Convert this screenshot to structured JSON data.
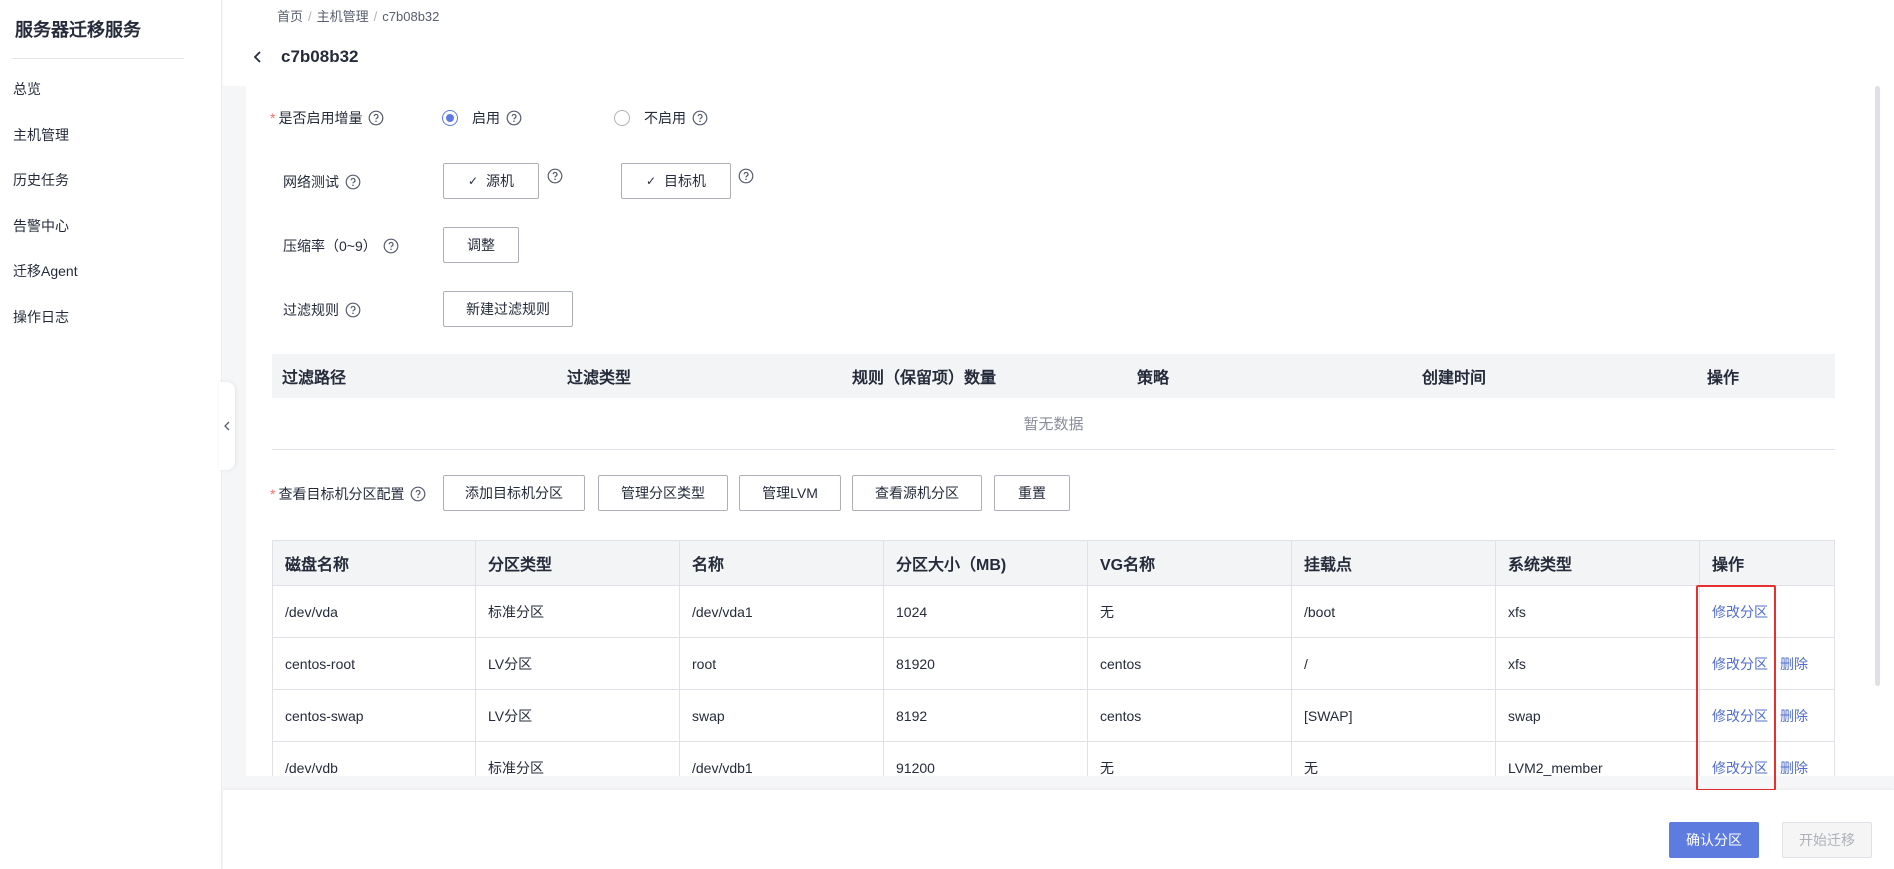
{
  "sidebar": {
    "title": "服务器迁移服务",
    "items": [
      {
        "label": "总览"
      },
      {
        "label": "主机管理"
      },
      {
        "label": "历史任务"
      },
      {
        "label": "告警中心"
      },
      {
        "label": "迁移Agent"
      },
      {
        "label": "操作日志"
      }
    ]
  },
  "header": {
    "breadcrumb": [
      "首页",
      "主机管理",
      "c7b08b32"
    ],
    "title": "c7b08b32"
  },
  "form": {
    "incremental": {
      "label": "是否启用增量",
      "options": [
        {
          "label": "启用",
          "selected": true
        },
        {
          "label": "不启用",
          "selected": false
        }
      ]
    },
    "network_test": {
      "label": "网络测试",
      "source_button": "源机",
      "target_button": "目标机"
    },
    "compression": {
      "label": "压缩率（0~9）",
      "button": "调整"
    },
    "filter": {
      "label": "过滤规则",
      "button": "新建过滤规则",
      "columns": [
        "过滤路径",
        "过滤类型",
        "规则（保留项）数量",
        "策略",
        "创建时间",
        "操作"
      ],
      "empty_text": "暂无数据"
    },
    "partition": {
      "label": "查看目标机分区配置",
      "buttons": [
        "添加目标机分区",
        "管理分区类型",
        "管理LVM",
        "查看源机分区",
        "重置"
      ],
      "columns": [
        "磁盘名称",
        "分区类型",
        "名称",
        "分区大小（MB)",
        "VG名称",
        "挂载点",
        "系统类型",
        "操作"
      ],
      "rows": [
        {
          "disk": "/dev/vda",
          "type": "标准分区",
          "name": "/dev/vda1",
          "size": "1024",
          "vg": "无",
          "mount": "/boot",
          "fs": "xfs",
          "actions": [
            "修改分区"
          ]
        },
        {
          "disk": "centos-root",
          "type": "LV分区",
          "name": "root",
          "size": "81920",
          "vg": "centos",
          "mount": "/",
          "fs": "xfs",
          "actions": [
            "修改分区",
            "删除"
          ]
        },
        {
          "disk": "centos-swap",
          "type": "LV分区",
          "name": "swap",
          "size": "8192",
          "vg": "centos",
          "mount": "[SWAP]",
          "fs": "swap",
          "actions": [
            "修改分区",
            "删除"
          ]
        },
        {
          "disk": "/dev/vdb",
          "type": "标准分区",
          "name": "/dev/vdb1",
          "size": "91200",
          "vg": "无",
          "mount": "无",
          "fs": "LVM2_member",
          "actions": [
            "修改分区",
            "删除"
          ]
        }
      ]
    }
  },
  "footer": {
    "confirm_button": "确认分区",
    "start_button": "开始迁移"
  },
  "colors": {
    "primary": "#5e7ce0",
    "link": "#526ecc",
    "required": "#f66f6a",
    "highlight": "#e63030"
  }
}
